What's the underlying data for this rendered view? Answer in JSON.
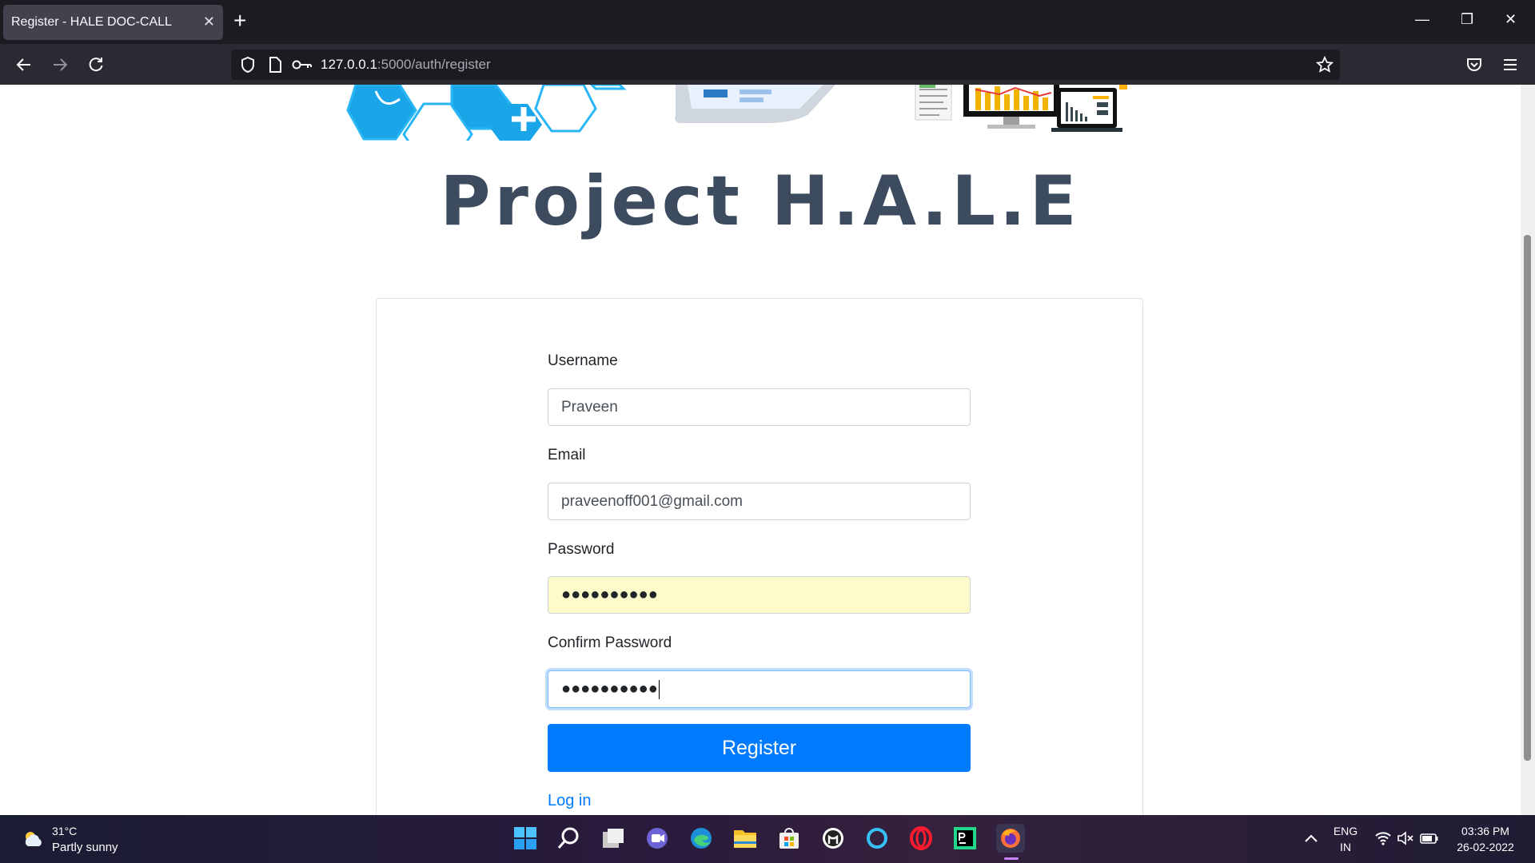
{
  "browser": {
    "tab_title": "Register - HALE DOC-CALL",
    "url_host": "127.0.0.1",
    "url_path": ":5000/auth/register"
  },
  "page": {
    "title": "Project H.A.L.E",
    "form": {
      "username_label": "Username",
      "username_value": "Praveen",
      "email_label": "Email",
      "email_value": "praveenoff001@gmail.com",
      "password_label": "Password",
      "password_value": "●●●●●●●●●●",
      "confirm_label": "Confirm Password",
      "confirm_value": "●●●●●●●●●●",
      "submit_label": "Register",
      "login_link": "Log in"
    }
  },
  "taskbar": {
    "weather_temp": "31°C",
    "weather_desc": "Partly sunny",
    "lang_top": "ENG",
    "lang_bottom": "IN",
    "time": "03:36 PM",
    "date": "26-02-2022"
  },
  "colors": {
    "accent": "#007bff",
    "title": "#3d4b5f",
    "autofill": "#fefbcb"
  }
}
